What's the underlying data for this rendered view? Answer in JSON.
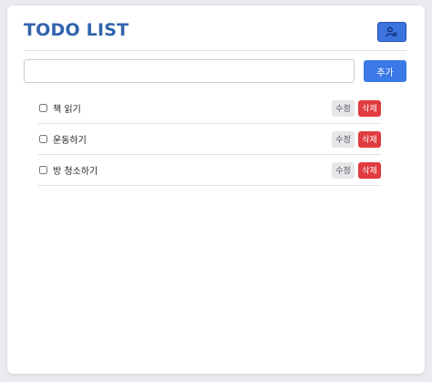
{
  "header": {
    "title": "TODO LIST",
    "user_icon": "user-gear-icon"
  },
  "input": {
    "value": "",
    "placeholder": "",
    "add_label": "추가"
  },
  "todos": [
    {
      "text": "책 읽기",
      "checked": false,
      "edit_label": "수정",
      "delete_label": "삭제"
    },
    {
      "text": "운동하기",
      "checked": false,
      "edit_label": "수정",
      "delete_label": "삭제"
    },
    {
      "text": "방 청소하기",
      "checked": false,
      "edit_label": "수정",
      "delete_label": "삭제"
    }
  ],
  "colors": {
    "title": "#3163ad",
    "primary": "#3b7ae6",
    "danger": "#e03b3f",
    "muted_button": "#e6e7ea"
  }
}
